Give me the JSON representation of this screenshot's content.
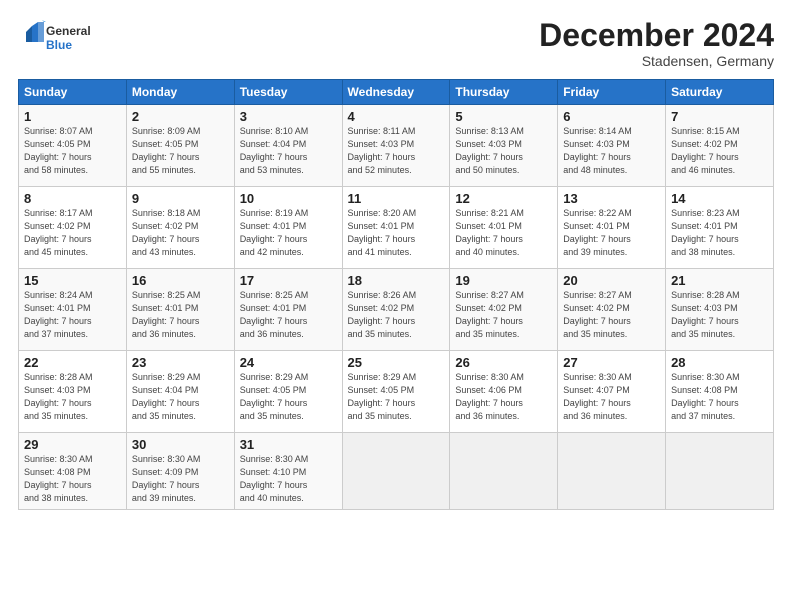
{
  "header": {
    "logo_general": "General",
    "logo_blue": "Blue",
    "month": "December 2024",
    "location": "Stadensen, Germany"
  },
  "days_of_week": [
    "Sunday",
    "Monday",
    "Tuesday",
    "Wednesday",
    "Thursday",
    "Friday",
    "Saturday"
  ],
  "weeks": [
    [
      {
        "day": "1",
        "info": "Sunrise: 8:07 AM\nSunset: 4:05 PM\nDaylight: 7 hours\nand 58 minutes."
      },
      {
        "day": "2",
        "info": "Sunrise: 8:09 AM\nSunset: 4:05 PM\nDaylight: 7 hours\nand 55 minutes."
      },
      {
        "day": "3",
        "info": "Sunrise: 8:10 AM\nSunset: 4:04 PM\nDaylight: 7 hours\nand 53 minutes."
      },
      {
        "day": "4",
        "info": "Sunrise: 8:11 AM\nSunset: 4:03 PM\nDaylight: 7 hours\nand 52 minutes."
      },
      {
        "day": "5",
        "info": "Sunrise: 8:13 AM\nSunset: 4:03 PM\nDaylight: 7 hours\nand 50 minutes."
      },
      {
        "day": "6",
        "info": "Sunrise: 8:14 AM\nSunset: 4:03 PM\nDaylight: 7 hours\nand 48 minutes."
      },
      {
        "day": "7",
        "info": "Sunrise: 8:15 AM\nSunset: 4:02 PM\nDaylight: 7 hours\nand 46 minutes."
      }
    ],
    [
      {
        "day": "8",
        "info": "Sunrise: 8:17 AM\nSunset: 4:02 PM\nDaylight: 7 hours\nand 45 minutes."
      },
      {
        "day": "9",
        "info": "Sunrise: 8:18 AM\nSunset: 4:02 PM\nDaylight: 7 hours\nand 43 minutes."
      },
      {
        "day": "10",
        "info": "Sunrise: 8:19 AM\nSunset: 4:01 PM\nDaylight: 7 hours\nand 42 minutes."
      },
      {
        "day": "11",
        "info": "Sunrise: 8:20 AM\nSunset: 4:01 PM\nDaylight: 7 hours\nand 41 minutes."
      },
      {
        "day": "12",
        "info": "Sunrise: 8:21 AM\nSunset: 4:01 PM\nDaylight: 7 hours\nand 40 minutes."
      },
      {
        "day": "13",
        "info": "Sunrise: 8:22 AM\nSunset: 4:01 PM\nDaylight: 7 hours\nand 39 minutes."
      },
      {
        "day": "14",
        "info": "Sunrise: 8:23 AM\nSunset: 4:01 PM\nDaylight: 7 hours\nand 38 minutes."
      }
    ],
    [
      {
        "day": "15",
        "info": "Sunrise: 8:24 AM\nSunset: 4:01 PM\nDaylight: 7 hours\nand 37 minutes."
      },
      {
        "day": "16",
        "info": "Sunrise: 8:25 AM\nSunset: 4:01 PM\nDaylight: 7 hours\nand 36 minutes."
      },
      {
        "day": "17",
        "info": "Sunrise: 8:25 AM\nSunset: 4:01 PM\nDaylight: 7 hours\nand 36 minutes."
      },
      {
        "day": "18",
        "info": "Sunrise: 8:26 AM\nSunset: 4:02 PM\nDaylight: 7 hours\nand 35 minutes."
      },
      {
        "day": "19",
        "info": "Sunrise: 8:27 AM\nSunset: 4:02 PM\nDaylight: 7 hours\nand 35 minutes."
      },
      {
        "day": "20",
        "info": "Sunrise: 8:27 AM\nSunset: 4:02 PM\nDaylight: 7 hours\nand 35 minutes."
      },
      {
        "day": "21",
        "info": "Sunrise: 8:28 AM\nSunset: 4:03 PM\nDaylight: 7 hours\nand 35 minutes."
      }
    ],
    [
      {
        "day": "22",
        "info": "Sunrise: 8:28 AM\nSunset: 4:03 PM\nDaylight: 7 hours\nand 35 minutes."
      },
      {
        "day": "23",
        "info": "Sunrise: 8:29 AM\nSunset: 4:04 PM\nDaylight: 7 hours\nand 35 minutes."
      },
      {
        "day": "24",
        "info": "Sunrise: 8:29 AM\nSunset: 4:05 PM\nDaylight: 7 hours\nand 35 minutes."
      },
      {
        "day": "25",
        "info": "Sunrise: 8:29 AM\nSunset: 4:05 PM\nDaylight: 7 hours\nand 35 minutes."
      },
      {
        "day": "26",
        "info": "Sunrise: 8:30 AM\nSunset: 4:06 PM\nDaylight: 7 hours\nand 36 minutes."
      },
      {
        "day": "27",
        "info": "Sunrise: 8:30 AM\nSunset: 4:07 PM\nDaylight: 7 hours\nand 36 minutes."
      },
      {
        "day": "28",
        "info": "Sunrise: 8:30 AM\nSunset: 4:08 PM\nDaylight: 7 hours\nand 37 minutes."
      }
    ],
    [
      {
        "day": "29",
        "info": "Sunrise: 8:30 AM\nSunset: 4:08 PM\nDaylight: 7 hours\nand 38 minutes."
      },
      {
        "day": "30",
        "info": "Sunrise: 8:30 AM\nSunset: 4:09 PM\nDaylight: 7 hours\nand 39 minutes."
      },
      {
        "day": "31",
        "info": "Sunrise: 8:30 AM\nSunset: 4:10 PM\nDaylight: 7 hours\nand 40 minutes."
      },
      null,
      null,
      null,
      null
    ]
  ]
}
